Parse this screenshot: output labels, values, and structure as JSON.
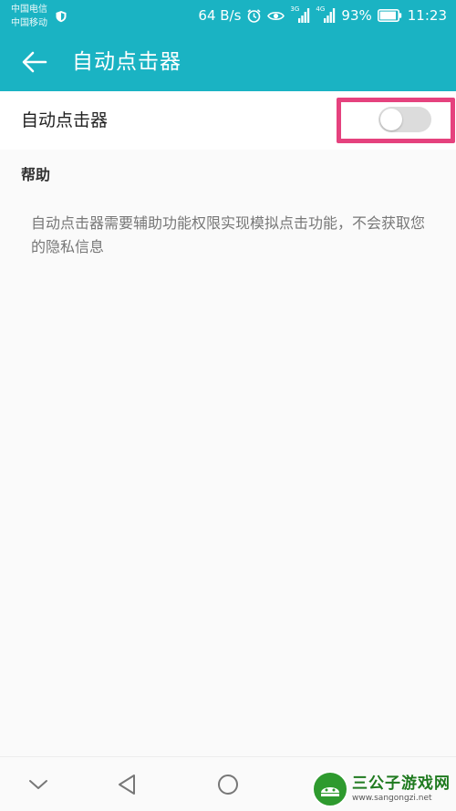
{
  "status_bar": {
    "carrier_1": "中国电信",
    "carrier_2": "中国移动",
    "speed": "64 B/s",
    "signal_1_label": "3G",
    "signal_2_label": "4G",
    "battery": "93%",
    "battery_level": 0.93,
    "time": "11:23"
  },
  "app_bar": {
    "title": "自动点击器",
    "back_icon": "arrow-left-icon",
    "color": "#1ab3c3"
  },
  "setting": {
    "label": "自动点击器",
    "toggle_on": false,
    "highlight_color": "#e5427e"
  },
  "help": {
    "header": "帮助",
    "text": "自动点击器需要辅助功能权限实现模拟点击功能，不会获取您的隐私信息"
  },
  "nav_bar": {
    "icons": [
      "chevron-down-icon",
      "back-triangle-icon",
      "home-circle-icon",
      "recents-square-icon"
    ]
  },
  "watermark": {
    "name": "三公子游戏网",
    "url": "www.sangongzi.net"
  }
}
